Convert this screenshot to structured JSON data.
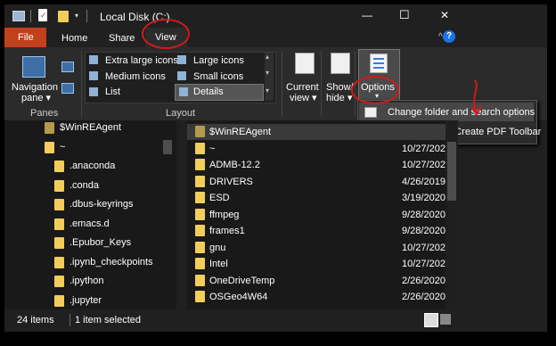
{
  "titlebar": {
    "title": "Local Disk (C:)",
    "minimize": "—",
    "maximize": "☐",
    "close": "✕"
  },
  "ribbon_tabs": [
    {
      "label": "File"
    },
    {
      "label": "Home"
    },
    {
      "label": "Share"
    },
    {
      "label": "View"
    }
  ],
  "ribbon": {
    "navigation_pane": [
      "Navigation",
      "pane ▾"
    ],
    "panes_label": "Panes",
    "layout_label": "Layout",
    "layouts": [
      "Extra large icons",
      "Large icons",
      "Medium icons",
      "Small icons",
      "List",
      "Details"
    ],
    "current_view": [
      "Current",
      "view ▾"
    ],
    "show_hide": [
      "Show/",
      "hide ▾"
    ],
    "options": "Options",
    "collapse": "^",
    "help": "?"
  },
  "options_menu": {
    "items": [
      "Change folder and search options",
      "Adobe Acrobat Create PDF Toolbar"
    ]
  },
  "nav_pane": {
    "items": [
      "$WinREAgent",
      "~",
      ".anaconda",
      ".conda",
      ".dbus-keyrings",
      ".emacs.d",
      ".Epubor_Keys",
      ".ipynb_checkpoints",
      ".ipython",
      ".jupyter"
    ]
  },
  "files": [
    {
      "name": "$WinREAgent",
      "date": ""
    },
    {
      "name": "~",
      "date": "10/27/2020"
    },
    {
      "name": "ADMB-12.2",
      "date": "10/27/2020"
    },
    {
      "name": "DRIVERS",
      "date": "4/26/2019"
    },
    {
      "name": "ESD",
      "date": "3/19/2020"
    },
    {
      "name": "ffmpeg",
      "date": "9/28/2020"
    },
    {
      "name": "frames1",
      "date": "9/28/2020"
    },
    {
      "name": "gnu",
      "date": "10/27/2020"
    },
    {
      "name": "Intel",
      "date": "10/27/2020"
    },
    {
      "name": "OneDriveTemp",
      "date": "2/26/2020"
    },
    {
      "name": "OSGeo4W64",
      "date": "2/26/2020"
    }
  ],
  "status": {
    "count": "24 items",
    "selected": "1 item selected"
  }
}
